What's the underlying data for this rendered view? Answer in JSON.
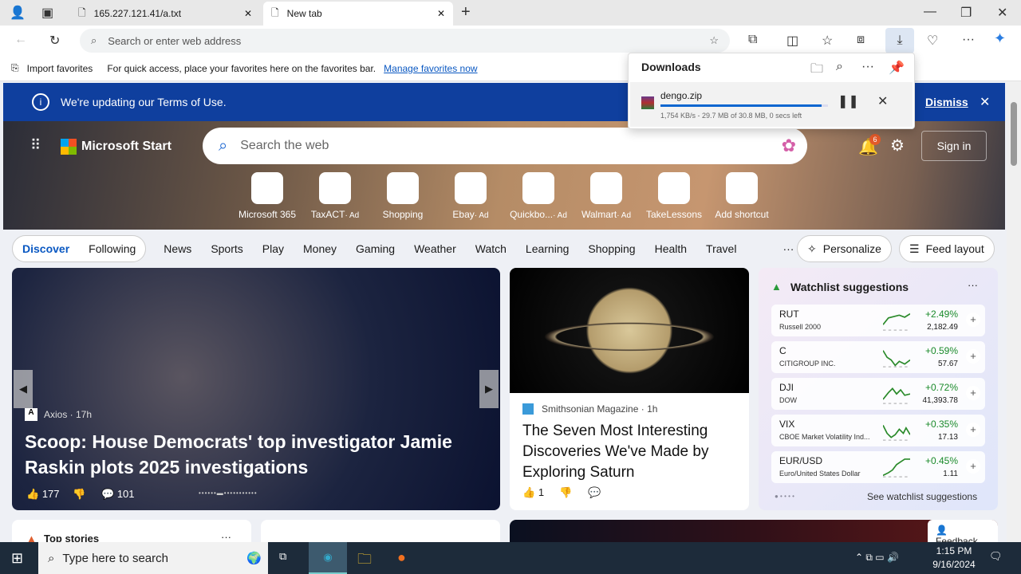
{
  "browser": {
    "tabs": [
      {
        "title": "165.227.121.41/a.txt"
      },
      {
        "title": "New tab"
      }
    ],
    "address_placeholder": "Search or enter web address",
    "favorites": {
      "import": "Import favorites",
      "message": "For quick access, place your favorites here on the favorites bar.",
      "manage_link": "Manage favorites now"
    }
  },
  "downloads": {
    "title": "Downloads",
    "file": "dengo.zip",
    "status": "1,754 KB/s - 29.7 MB of 30.8 MB, 0 secs left",
    "progress_percent": 96
  },
  "banner": {
    "text": "We're updating our Terms of Use.",
    "dismiss": "Dismiss"
  },
  "header": {
    "brand": "Microsoft Start",
    "search_placeholder": "Search the web",
    "notification_count": "6",
    "sign_in": "Sign in"
  },
  "shortcuts": [
    {
      "label": "Microsoft 365",
      "glyph": "◉"
    },
    {
      "label": "TaxACT",
      "ad": "· Ad",
      "glyph": "X"
    },
    {
      "label": "Shopping",
      "glyph": "◇"
    },
    {
      "label": "Ebay",
      "ad": "· Ad",
      "glyph": "▦"
    },
    {
      "label": "Quickbo...",
      "ad": "· Ad",
      "glyph": "qb"
    },
    {
      "label": "Walmart",
      "ad": "· Ad",
      "glyph": "✳"
    },
    {
      "label": "TakeLessons",
      "glyph": "tl"
    },
    {
      "label": "Add shortcut",
      "glyph": "+"
    }
  ],
  "nav": {
    "discover": "Discover",
    "following": "Following",
    "items": [
      "News",
      "Sports",
      "Play",
      "Money",
      "Gaming",
      "Weather",
      "Watch",
      "Learning",
      "Shopping",
      "Health",
      "Travel"
    ],
    "more": "···",
    "personalize": "Personalize",
    "feed_layout": "Feed layout"
  },
  "main_story": {
    "source": "Axios · 17h",
    "headline": "Scoop: House Democrats' top investigator Jamie Raskin plots 2025 investigations",
    "likes": "177",
    "comments": "101"
  },
  "saturn_story": {
    "source": "Smithsonian Magazine · 1h",
    "headline": "The Seven Most Interesting Discoveries We've Made by Exploring Saturn",
    "likes": "1"
  },
  "watchlist": {
    "title": "Watchlist suggestions",
    "more": "···",
    "link": "See watchlist suggestions",
    "items": [
      {
        "symbol": "RUT",
        "name": "Russell 2000",
        "change": "+2.49%",
        "price": "2,182.49"
      },
      {
        "symbol": "C",
        "name": "CITIGROUP INC.",
        "change": "+0.59%",
        "price": "57.67"
      },
      {
        "symbol": "DJI",
        "name": "DOW",
        "change": "+0.72%",
        "price": "41,393.78"
      },
      {
        "symbol": "VIX",
        "name": "CBOE Market Volatility Ind...",
        "change": "+0.35%",
        "price": "17.13"
      },
      {
        "symbol": "EUR/USD",
        "name": "Euro/United States Dollar",
        "change": "+0.45%",
        "price": "1.11"
      }
    ]
  },
  "top_stories": {
    "title": "Top stories"
  },
  "feedback": "Feedback",
  "taskbar": {
    "search_placeholder": "Type here to search",
    "time": "1:15 PM",
    "date": "9/16/2024"
  }
}
